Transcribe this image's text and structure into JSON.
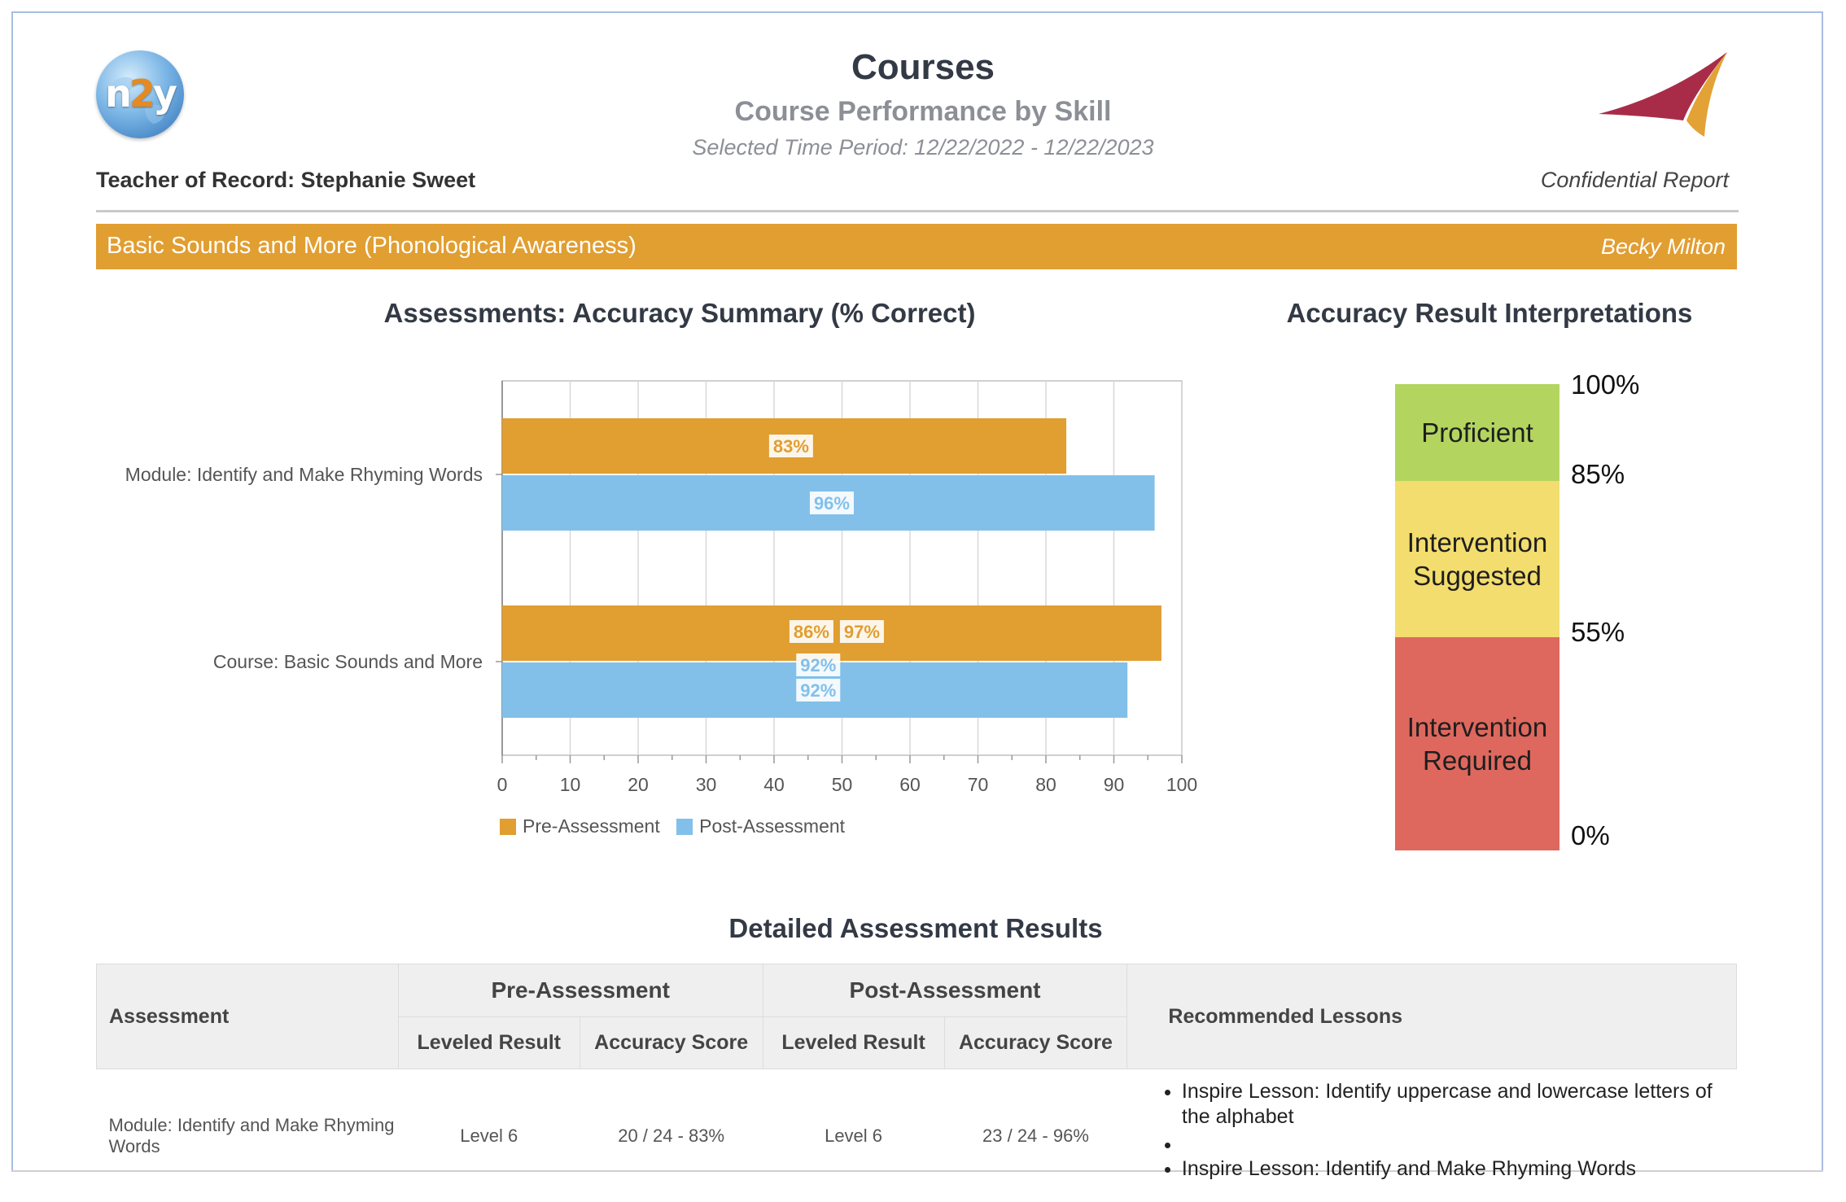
{
  "header": {
    "logo_text_prefix": "n",
    "logo_text_mid": "2",
    "logo_text_suffix": "y",
    "title": "Courses",
    "subtitle": "Course Performance by Skill",
    "time_period": "Selected Time Period: 12/22/2022 - 12/22/2023",
    "teacher": "Teacher of Record: Stephanie Sweet",
    "confidential": "Confidential Report"
  },
  "course_bar": {
    "course_name": "Basic Sounds and More (Phonological Awareness)",
    "student_name": "Becky Milton"
  },
  "chart_section": {
    "title": "Assessments: Accuracy Summary (% Correct)"
  },
  "chart_data": {
    "type": "bar",
    "orientation": "horizontal",
    "categories": [
      "Module: Identify and Make Rhyming Words",
      "Course: Basic Sounds and More"
    ],
    "series": [
      {
        "name": "Pre-Assessment",
        "color": "#e19e31",
        "values": [
          83,
          97
        ],
        "labels": [
          [
            "83%"
          ],
          [
            "86%",
            "97%"
          ]
        ]
      },
      {
        "name": "Post-Assessment",
        "color": "#82c0ea",
        "values": [
          96,
          92
        ],
        "labels": [
          [
            "96%"
          ],
          [
            "92%",
            "92%"
          ]
        ]
      }
    ],
    "xlim": [
      0,
      100
    ],
    "xticks": [
      0,
      10,
      20,
      30,
      40,
      50,
      60,
      70,
      80,
      90,
      100
    ],
    "grid": true,
    "legend": "bottom-left",
    "legend_labels": [
      "Pre-Assessment",
      "Post-Assessment"
    ]
  },
  "interpretations": {
    "title": "Accuracy Result Interpretations",
    "bands": [
      {
        "label": "Proficient",
        "color": "#b3d55f"
      },
      {
        "label": "Intervention Suggested",
        "color": "#f2dd6e"
      },
      {
        "label": "Intervention Required",
        "color": "#de685e"
      }
    ],
    "thresholds": [
      "100%",
      "85%",
      "55%",
      "0%"
    ]
  },
  "details": {
    "title": "Detailed Assessment Results",
    "headers": {
      "assessment": "Assessment",
      "pre": "Pre-Assessment",
      "post": "Post-Assessment",
      "lessons": "Recommended Lessons",
      "leveled": "Leveled Result",
      "accuracy": "Accuracy Score"
    },
    "rows": [
      {
        "assessment": "Module: Identify and Make Rhyming Words",
        "pre_level": "Level 6",
        "pre_score": "20 / 24 - 83%",
        "post_level": "Level 6",
        "post_score": "23 / 24 - 96%",
        "lessons": [
          "Inspire Lesson: Identify uppercase and lowercase letters of the alphabet",
          "",
          "Inspire Lesson: Identify and Make Rhyming Words"
        ]
      }
    ]
  }
}
